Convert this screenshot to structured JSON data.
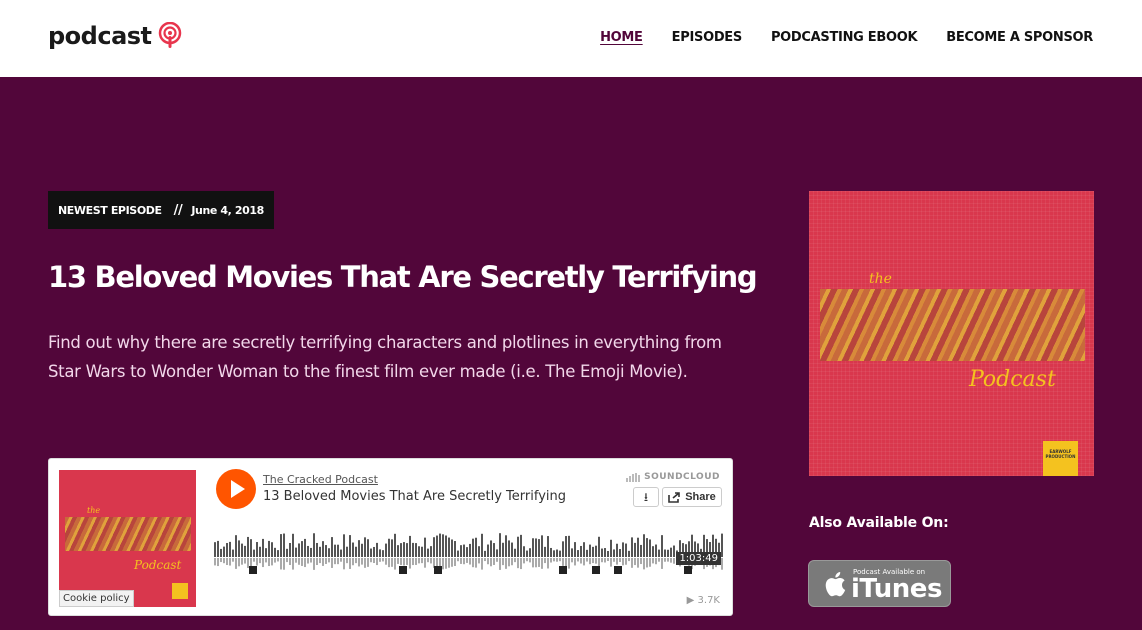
{
  "header": {
    "logo_text": "podcast",
    "logo_icon": "podcast-icon",
    "nav": [
      {
        "label": "HOME",
        "active": true
      },
      {
        "label": "EPISODES",
        "active": false
      },
      {
        "label": "PODCASTING EBOOK",
        "active": false
      },
      {
        "label": "BECOME A SPONSOR",
        "active": false
      }
    ]
  },
  "episode": {
    "badge_label": "NEWEST EPISODE",
    "badge_sep": "//",
    "date": "June 4, 2018",
    "title": "13 Beloved Movies That Are Secretly Terrifying",
    "description": "Find out why there are secretly terrifying characters and plotlines in everything from Star Wars to Wonder Woman to the finest film ever made (i.e. The Emoji Movie)."
  },
  "player": {
    "author": "The Cracked Podcast",
    "track": "13 Beloved Movies That Are Secretly Terrifying",
    "brand": "SOUNDCLOUD",
    "share_label": "Share",
    "duration": "1:03:49",
    "plays": "3.7K",
    "cookie_policy": "Cookie policy",
    "art_the": "the",
    "art_podcast": "Podcast"
  },
  "sidebar": {
    "cover_the": "the",
    "cover_podcast": "Podcast",
    "cover_tag": "EARWOLF PRODUCTION",
    "available_label": "Also Available On:",
    "itunes_small": "Podcast Available on",
    "itunes_big": "iTunes"
  },
  "colors": {
    "background": "#52063a",
    "accent": "#ff5500",
    "cover": "#d9374d",
    "gold": "#f4c21f"
  }
}
